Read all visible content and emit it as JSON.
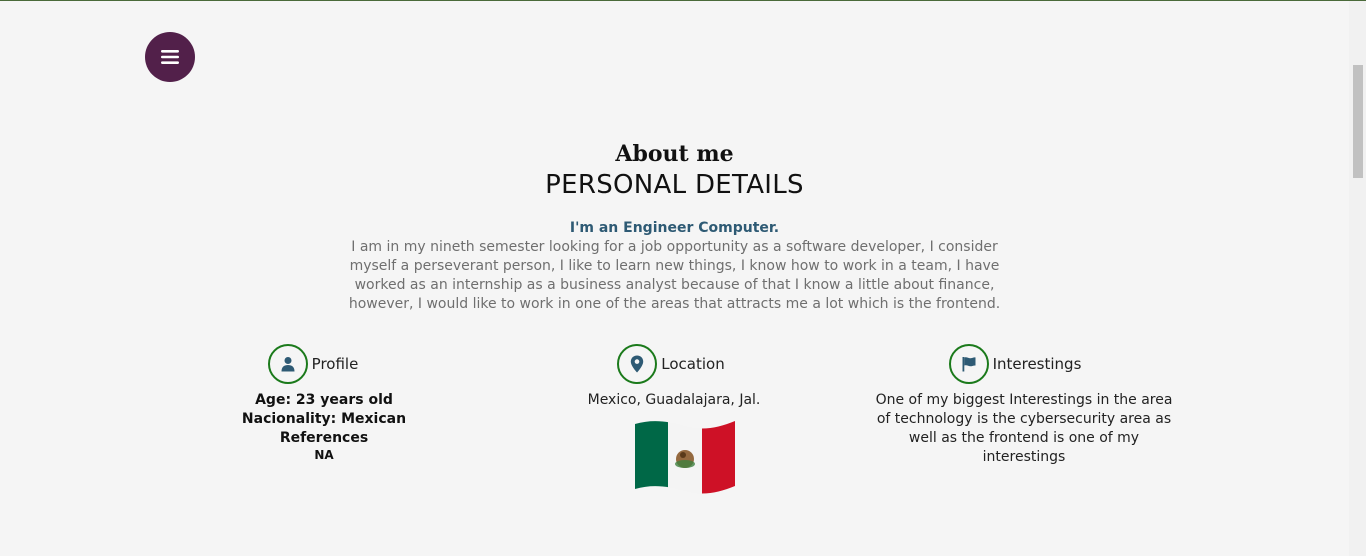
{
  "header": {
    "menu_icon": "hamburger-menu-icon",
    "menu_color": "#52204a"
  },
  "section": {
    "eyebrow": "About me",
    "title": "PERSONAL DETAILS",
    "subtitle": "I'm an Engineer Computer.",
    "bio": "I am in my nineth semester looking for a job opportunity as a software developer, I consider myself a perseverant person, I like to learn new things, I know how to work in a team, I have worked as an internship as a business analyst because of that I know a little about finance, however, I would like to work in one of the areas that attracts me a lot which is the frontend."
  },
  "profile": {
    "icon": "user-icon",
    "label": "Profile",
    "age": "Age: 23 years old",
    "nationality": "Nacionality: Mexican",
    "references_label": "References",
    "references_value": "NA"
  },
  "location": {
    "icon": "map-pin-icon",
    "label": "Location",
    "value": "Mexico, Guadalajara, Jal.",
    "flag_icon": "mexico-flag-icon"
  },
  "interests": {
    "icon": "flag-icon",
    "label": "Interestings",
    "text": "One of my biggest Interestings in the area of technology is the cybersecurity area as well as the frontend is one of my interestings"
  },
  "colors": {
    "accent_ring": "#1b7a1b",
    "icon_color": "#2e5a74",
    "subtitle_color": "#2e5a74"
  }
}
